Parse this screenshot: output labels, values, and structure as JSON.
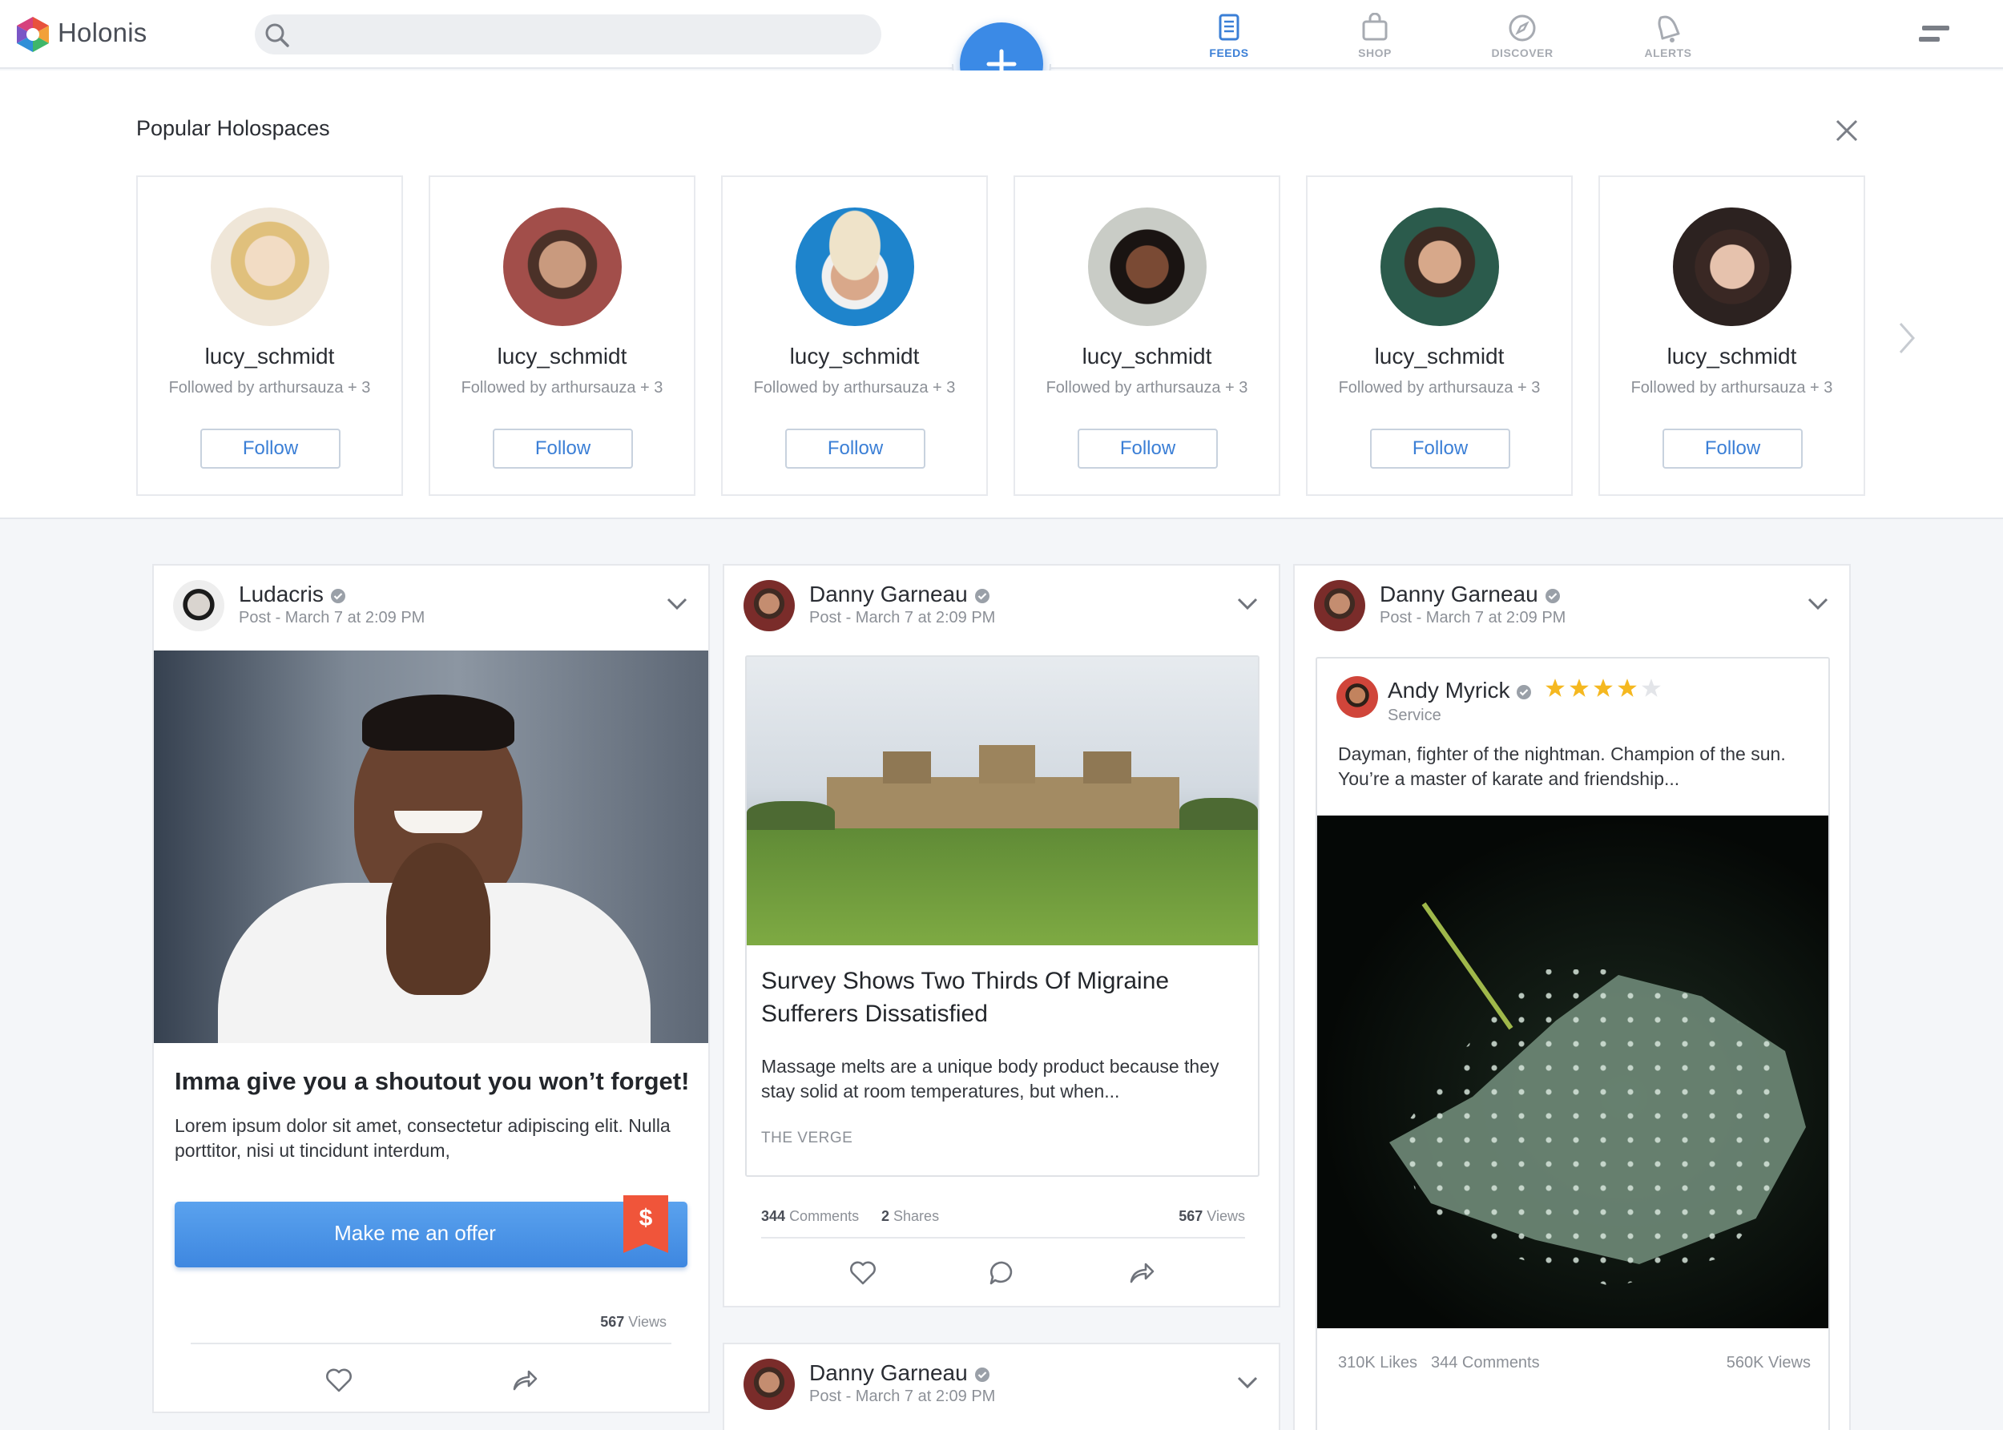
{
  "app": {
    "name": "Holonis"
  },
  "search": {
    "placeholder": ""
  },
  "nav": {
    "items": [
      {
        "label": "FEEDS",
        "icon": "feeds-icon",
        "active": true
      },
      {
        "label": "SHOP",
        "icon": "shop-icon",
        "active": false
      },
      {
        "label": "DISCOVER",
        "icon": "discover-icon",
        "active": false
      },
      {
        "label": "ALERTS",
        "icon": "alerts-icon",
        "active": false
      }
    ]
  },
  "holospaces": {
    "title": "Popular Holospaces",
    "cards": [
      {
        "name": "lucy_schmidt",
        "followed": "Followed by arthursauza + 3",
        "button": "Follow"
      },
      {
        "name": "lucy_schmidt",
        "followed": "Followed by arthursauza + 3",
        "button": "Follow"
      },
      {
        "name": "lucy_schmidt",
        "followed": "Followed by arthursauza + 3",
        "button": "Follow"
      },
      {
        "name": "lucy_schmidt",
        "followed": "Followed by arthursauza + 3",
        "button": "Follow"
      },
      {
        "name": "lucy_schmidt",
        "followed": "Followed by arthursauza + 3",
        "button": "Follow"
      },
      {
        "name": "lucy_schmidt",
        "followed": "Followed by arthursauza + 3",
        "button": "Follow"
      }
    ]
  },
  "feed": {
    "post1": {
      "author": "Ludacris",
      "meta": "Post - March 7 at 2:09 PM",
      "headline": "Imma give you a shoutout you won’t forget!",
      "body": "Lorem ipsum dolor sit amet, consectetur adipiscing elit. Nulla porttitor, nisi ut tincidunt interdum,",
      "cta": "Make me an offer",
      "cta_badge": "$",
      "views_count": "567",
      "views_label": "Views"
    },
    "post2": {
      "author": "Danny Garneau",
      "meta": "Post - March 7 at 2:09 PM",
      "headline": "Survey Shows Two Thirds Of Migraine Sufferers Dissatisfied",
      "body": "Massage melts are a unique body product because they stay solid at room temperatures, but when...",
      "source": "THE VERGE",
      "comments_count": "344",
      "comments_label": "Comments",
      "shares_count": "2",
      "shares_label": "Shares",
      "views_count": "567",
      "views_label": "Views"
    },
    "post3": {
      "author": "Danny Garneau",
      "meta": "Post - March 7 at 2:09 PM",
      "review": {
        "reviewer": "Andy Myrick",
        "rating": 4,
        "rating_max": 5,
        "category": "Service",
        "text": "Dayman, fighter of the nightman. Champion of the sun. You’re a master of karate and friendship..."
      },
      "likes": "310K Likes",
      "comments": "344 Comments",
      "views": "560K Views"
    },
    "post4": {
      "author": "Danny Garneau",
      "meta": "Post - March 7 at 2:09 PM"
    }
  },
  "colors": {
    "accent": "#3b8ae6",
    "cta": "#4a93e8",
    "badge": "#f0553a",
    "star": "#f5b820"
  }
}
